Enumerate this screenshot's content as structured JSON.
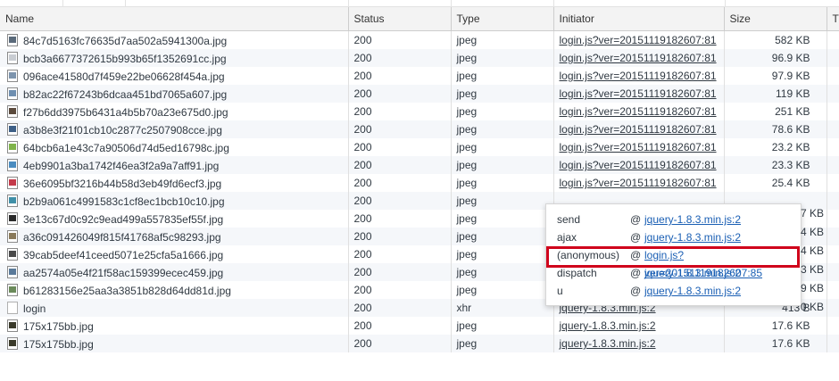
{
  "columns": {
    "name": "Name",
    "status": "Status",
    "type": "Type",
    "initiator": "Initiator",
    "size": "Size",
    "time": "Ti"
  },
  "rows": [
    {
      "name": "84c7d5163fc76635d7aa502a5941300a.jpg",
      "status": "200",
      "type": "jpeg",
      "initiator": "login.js?ver=20151119182607:81",
      "size": "582 KB",
      "icon_color": "#5a6a7a"
    },
    {
      "name": "bcb3a6677372615b993b65f1352691cc.jpg",
      "status": "200",
      "type": "jpeg",
      "initiator": "login.js?ver=20151119182607:81",
      "size": "96.9 KB",
      "icon_color": "#c8ccd2"
    },
    {
      "name": "096ace41580d7f459e22be06628f454a.jpg",
      "status": "200",
      "type": "jpeg",
      "initiator": "login.js?ver=20151119182607:81",
      "size": "97.9 KB",
      "icon_color": "#7d94ad"
    },
    {
      "name": "b82ac22f67243b6dcaa451bd7065a607.jpg",
      "status": "200",
      "type": "jpeg",
      "initiator": "login.js?ver=20151119182607:81",
      "size": "119 KB",
      "icon_color": "#6f8fb0"
    },
    {
      "name": "f27b6dd3975b6431a4b5b70a23e675d0.jpg",
      "status": "200",
      "type": "jpeg",
      "initiator": "login.js?ver=20151119182607:81",
      "size": "251 KB",
      "icon_color": "#5b4a3c"
    },
    {
      "name": "a3b8e3f21f01cb10c2877c2507908cce.jpg",
      "status": "200",
      "type": "jpeg",
      "initiator": "login.js?ver=20151119182607:81",
      "size": "78.6 KB",
      "icon_color": "#3d5f86"
    },
    {
      "name": "64bcb6a1e43c7a90506d74d5ed16798c.jpg",
      "status": "200",
      "type": "jpeg",
      "initiator": "login.js?ver=20151119182607:81",
      "size": "23.2 KB",
      "icon_color": "#7fb34a"
    },
    {
      "name": "4eb9901a3ba1742f46ea3f2a9a7aff91.jpg",
      "status": "200",
      "type": "jpeg",
      "initiator": "login.js?ver=20151119182607:81",
      "size": "23.3 KB",
      "icon_color": "#4a8cc0"
    },
    {
      "name": "36e6095bf3216b44b58d3eb49fd6ecf3.jpg",
      "status": "200",
      "type": "jpeg",
      "initiator": "login.js?ver=20151119182607:81",
      "size": "25.4 KB",
      "icon_color": "#c43a4a"
    },
    {
      "name": "b2b9a061c4991583c1cf8ec1bcb10c10.jpg",
      "status": "200",
      "type": "jpeg",
      "initiator": "",
      "size": "",
      "icon_color": "#3f8fa8"
    },
    {
      "name": "3e13c67d0c92c9ead499a557835ef55f.jpg",
      "status": "200",
      "type": "jpeg",
      "initiator": "",
      "size": "",
      "icon_color": "#2a2a2a"
    },
    {
      "name": "a36c091426049f815f41768af5c98293.jpg",
      "status": "200",
      "type": "jpeg",
      "initiator": "",
      "size": "",
      "icon_color": "#8a7a5a"
    },
    {
      "name": "39cab5deef41ceed5071e25cfa5a1666.jpg",
      "status": "200",
      "type": "jpeg",
      "initiator": "",
      "size": "",
      "icon_color": "#4a4a4a"
    },
    {
      "name": "aa2574a05e4f21f58ac159399ecec459.jpg",
      "status": "200",
      "type": "jpeg",
      "initiator": "",
      "size": "",
      "icon_color": "#5a7a9a"
    },
    {
      "name": "b61283156e25aa3a3851b828d64dd81d.jpg",
      "status": "200",
      "type": "jpeg",
      "initiator": "",
      "size": "",
      "icon_color": "#6a8a5a"
    },
    {
      "name": "login",
      "status": "200",
      "type": "xhr",
      "initiator": "jquery-1.8.3.min.js:2",
      "size": "413 B",
      "icon_color": ""
    },
    {
      "name": "175x175bb.jpg",
      "status": "200",
      "type": "jpeg",
      "initiator": "jquery-1.8.3.min.js:2",
      "size": "17.6 KB",
      "icon_color": "#3a3a2a"
    },
    {
      "name": "175x175bb.jpg",
      "status": "200",
      "type": "jpeg",
      "initiator": "jquery-1.8.3.min.js:2",
      "size": "17.6 KB",
      "icon_color": "#3a3a2a"
    }
  ],
  "clipped_sizes": [
    "7 KB",
    "4 KB",
    "4 KB",
    "3 KB",
    "9 KB",
    "0 KB"
  ],
  "stack_popover": {
    "frames": [
      {
        "function": "send",
        "at": "@",
        "source": "jquery-1.8.3.min.js:2"
      },
      {
        "function": "ajax",
        "at": "@",
        "source": "jquery-1.8.3.min.js:2"
      },
      {
        "function": "(anonymous)",
        "at": "@",
        "source": "login.js?ver=20151119182607:85"
      },
      {
        "function": "dispatch",
        "at": "@",
        "source": "jquery-1.8.3.min.js:2"
      },
      {
        "function": "u",
        "at": "@",
        "source": "jquery-1.8.3.min.js:2"
      }
    ]
  },
  "colors": {
    "highlight": "#d0021b",
    "link": "#1a5fb4",
    "header_bg": "#f3f3f3",
    "row_alt": "#f5f7fa"
  }
}
